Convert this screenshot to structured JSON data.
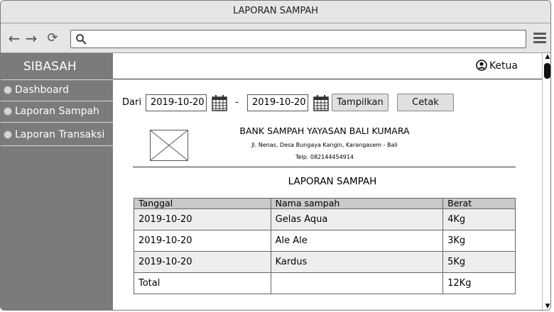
{
  "window": {
    "title": "LAPORAN SAMPAH"
  },
  "browser": {
    "url": ""
  },
  "sidebar": {
    "title": "SIBASAH",
    "items": [
      {
        "label": "Dashboard"
      },
      {
        "label": "Laporan Sampah"
      },
      {
        "label": "Laporan Transaksi"
      }
    ]
  },
  "header": {
    "user_label": "Ketua",
    "user_icon": "user-circle-icon"
  },
  "filter": {
    "from_label": "Dari",
    "from_date": "2019-10-20",
    "separator": "-",
    "to_date": "2019-10-20",
    "show_button": "Tampilkan",
    "print_button": "Cetak"
  },
  "report": {
    "org_name": "BANK SAMPAH YAYASAN BALI KUMARA",
    "address": "Jl. Nenas, Desa Bungaya Kangin, Karangasem - Bali",
    "phone": "Telp. 082144454914",
    "title": "LAPORAN SAMPAH",
    "columns": [
      "Tanggal",
      "Nama sampah",
      "Berat"
    ],
    "rows": [
      [
        "2019-10-20",
        "Gelas Aqua",
        "4Kg"
      ],
      [
        "2019-10-20",
        "Ale Ale",
        "3Kg"
      ],
      [
        "2019-10-20",
        "Kardus",
        "5Kg"
      ]
    ],
    "total_label": "Total",
    "total_name": "",
    "total_weight": "12Kg"
  }
}
